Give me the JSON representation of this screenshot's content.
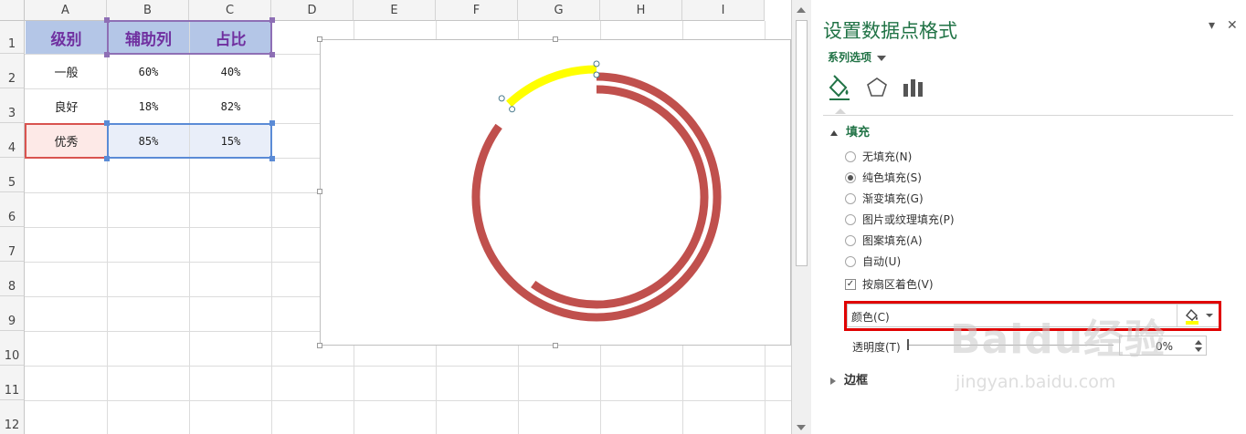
{
  "sheet": {
    "columns": [
      "A",
      "B",
      "C",
      "D",
      "E",
      "F",
      "G",
      "H",
      "I"
    ],
    "rows": [
      "1",
      "2",
      "3",
      "4",
      "5",
      "6",
      "7",
      "8",
      "9",
      "10",
      "11",
      "12"
    ],
    "table": {
      "headers": [
        "级别",
        "辅助列",
        "占比"
      ],
      "data": [
        [
          "一般",
          "60%",
          "40%"
        ],
        [
          "良好",
          "18%",
          "82%"
        ],
        [
          "优秀",
          "85%",
          "15%"
        ]
      ]
    },
    "colors": {
      "header_fill": "#b4c6e7",
      "header_text": "#7030a0",
      "selection_blue": "#5b8bd6",
      "selection_red": "#d9534f"
    }
  },
  "chart_data": {
    "type": "pie",
    "series": [
      {
        "name": "",
        "values": [
          85,
          15
        ],
        "colors": [
          "#c0504d",
          "#ffffff"
        ]
      },
      {
        "name": "",
        "values": [
          60,
          40
        ],
        "colors": [
          "#c0504d",
          "#ffffff"
        ],
        "selected_point_color": "#ffff00"
      }
    ]
  },
  "pane": {
    "title": "设置数据点格式",
    "pin_icon": "▾",
    "close_icon": "✕",
    "series_options": "系列选项",
    "tabs": [
      "fill-line-icon",
      "effects-pentagon-icon",
      "series-options-bars-icon"
    ],
    "fill_section": "填充",
    "options": [
      {
        "label": "无填充(N)",
        "selected": false
      },
      {
        "label": "纯色填充(S)",
        "selected": true
      },
      {
        "label": "渐变填充(G)",
        "selected": false
      },
      {
        "label": "图片或纹理填充(P)",
        "selected": false
      },
      {
        "label": "图案填充(A)",
        "selected": false
      },
      {
        "label": "自动(U)",
        "selected": false
      }
    ],
    "vary_colors": {
      "label": "按扇区着色(V)",
      "checked": true
    },
    "color_label": "颜色(C)",
    "selected_color": "#ffff00",
    "transparency_label": "透明度(T)",
    "transparency_value": "0%",
    "border_section": "边框"
  },
  "watermark": {
    "line1": "Baidu经验",
    "line2": "jingyan.baidu.com"
  }
}
